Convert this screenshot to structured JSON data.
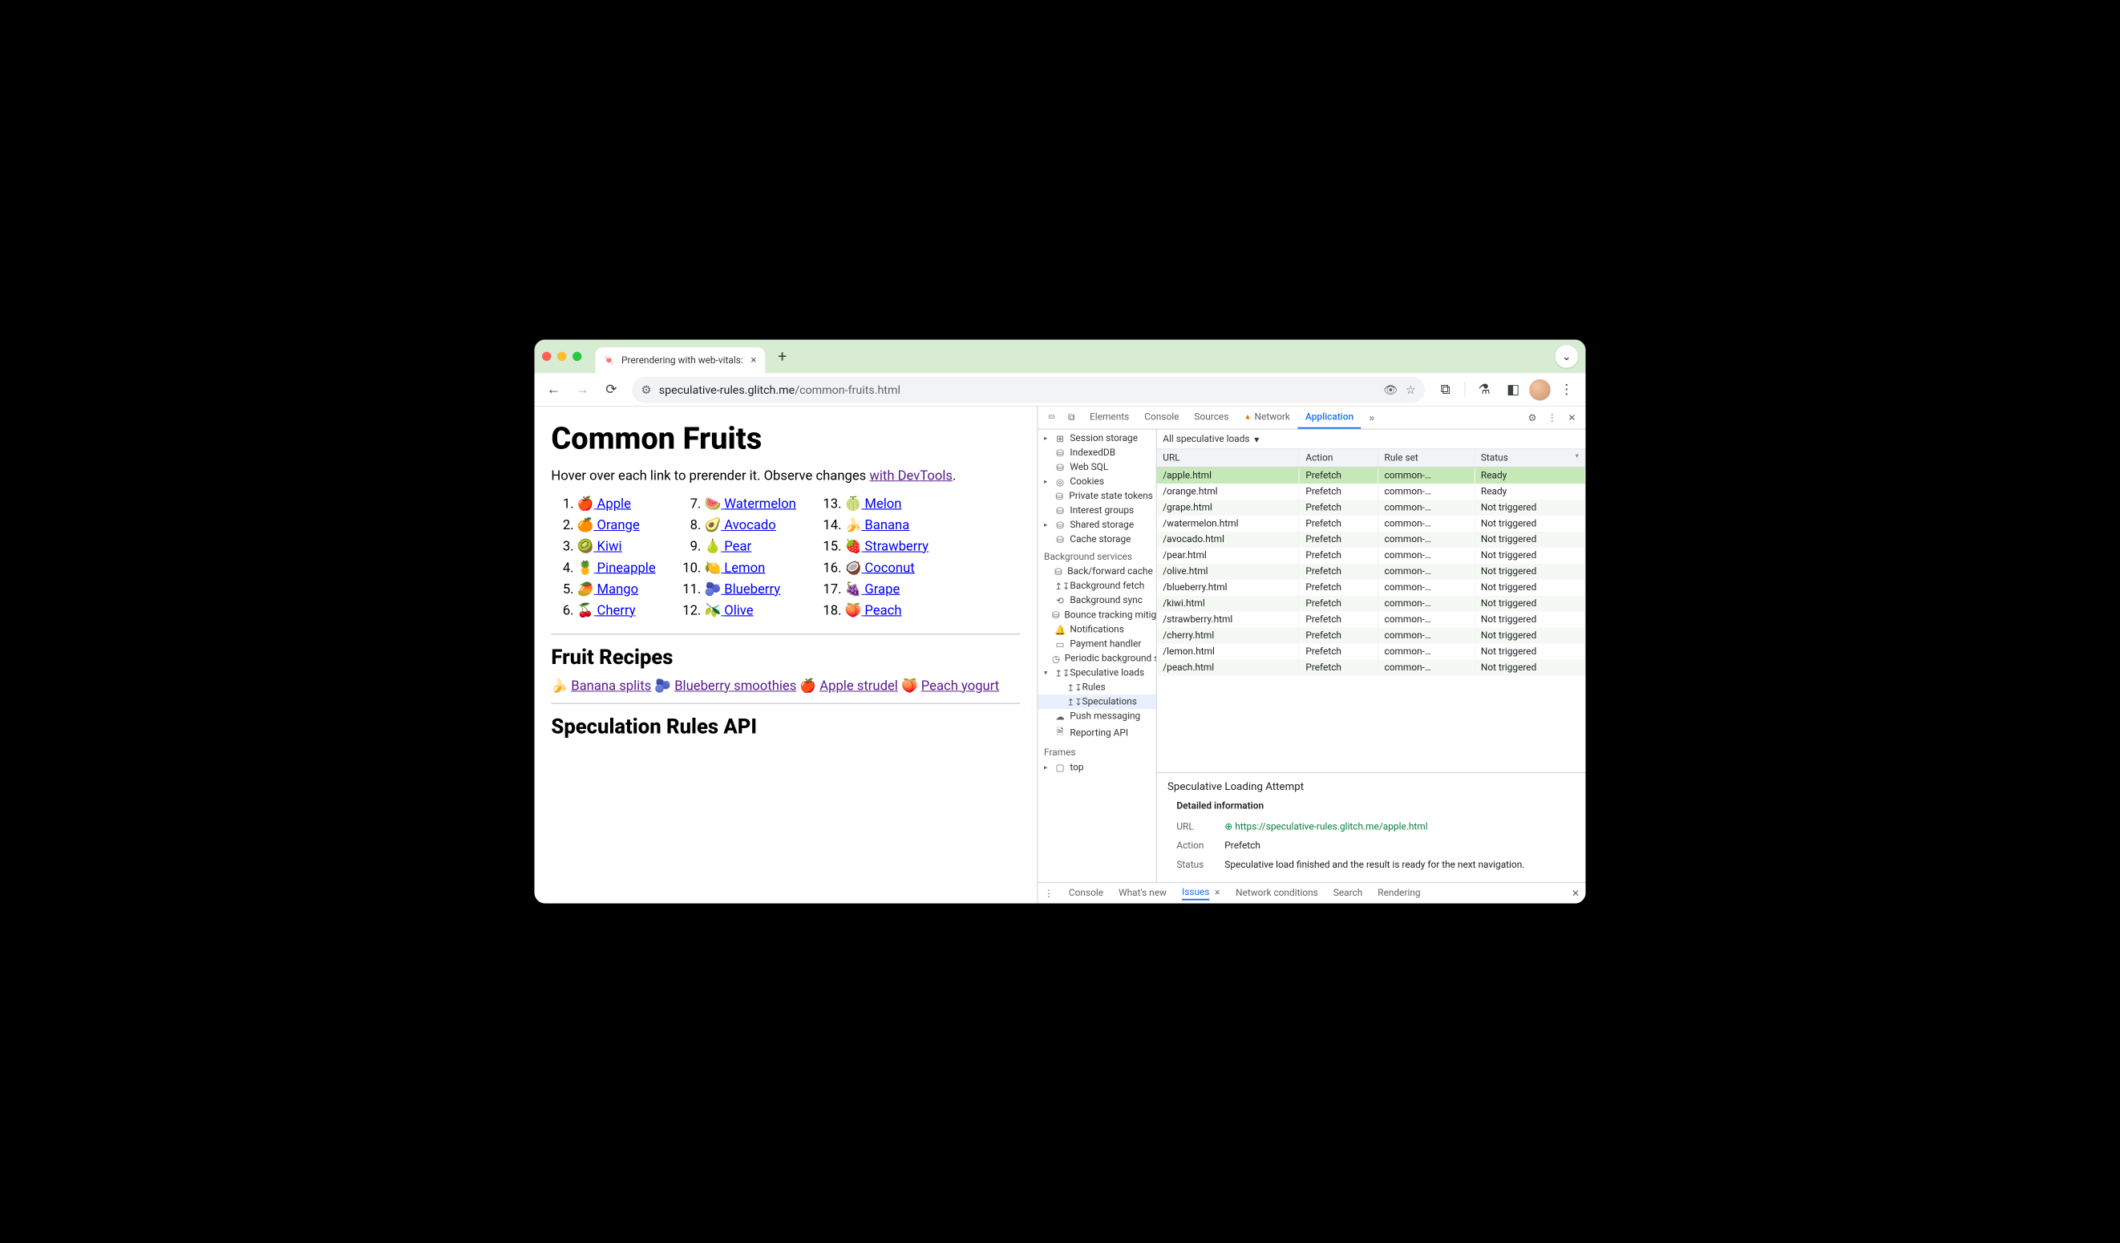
{
  "tab": {
    "title": "Prerendering with web-vitals:"
  },
  "url": {
    "host": "speculative-rules.glitch.me",
    "path": "/common-fruits.html"
  },
  "page": {
    "h1": "Common Fruits",
    "intro_a": "Hover over each link to prerender it. Observe changes ",
    "intro_link": "with DevTools",
    "intro_b": ".",
    "fruits": [
      {
        "n": "1.",
        "icon": "🍎",
        "label": "Apple"
      },
      {
        "n": "2.",
        "icon": "🍊",
        "label": "Orange"
      },
      {
        "n": "3.",
        "icon": "🥝",
        "label": "Kiwi"
      },
      {
        "n": "4.",
        "icon": "🍍",
        "label": "Pineapple"
      },
      {
        "n": "5.",
        "icon": "🥭",
        "label": "Mango"
      },
      {
        "n": "6.",
        "icon": "🍒",
        "label": "Cherry"
      },
      {
        "n": "7.",
        "icon": "🍉",
        "label": "Watermelon"
      },
      {
        "n": "8.",
        "icon": "🥑",
        "label": "Avocado"
      },
      {
        "n": "9.",
        "icon": "🍐",
        "label": "Pear"
      },
      {
        "n": "10.",
        "icon": "🍋",
        "label": "Lemon"
      },
      {
        "n": "11.",
        "icon": "🫐",
        "label": "Blueberry"
      },
      {
        "n": "12.",
        "icon": "🫒",
        "label": "Olive"
      },
      {
        "n": "13.",
        "icon": "🍈",
        "label": "Melon"
      },
      {
        "n": "14.",
        "icon": "🍌",
        "label": "Banana"
      },
      {
        "n": "15.",
        "icon": "🍓",
        "label": "Strawberry"
      },
      {
        "n": "16.",
        "icon": "🥥",
        "label": "Coconut"
      },
      {
        "n": "17.",
        "icon": "🍇",
        "label": "Grape"
      },
      {
        "n": "18.",
        "icon": "🍑",
        "label": "Peach"
      }
    ],
    "h2_recipes": "Fruit Recipes",
    "recipes": [
      {
        "icon": "🍌",
        "label": "Banana splits"
      },
      {
        "icon": "🫐",
        "label": "Blueberry smoothies"
      },
      {
        "icon": "🍎",
        "label": "Apple strudel"
      },
      {
        "icon": "🍑",
        "label": "Peach yogurt"
      }
    ],
    "h2_api": "Speculation Rules API"
  },
  "devtools": {
    "tabs": [
      "Elements",
      "Console",
      "Sources",
      "Network",
      "Application"
    ],
    "activeTab": "Application",
    "sidebar": {
      "storage": [
        {
          "label": "Session storage",
          "icon": "⊞",
          "caret": true
        },
        {
          "label": "IndexedDB",
          "icon": "⛁"
        },
        {
          "label": "Web SQL",
          "icon": "⛁"
        },
        {
          "label": "Cookies",
          "icon": "◎",
          "caret": true
        },
        {
          "label": "Private state tokens",
          "icon": "⛁"
        },
        {
          "label": "Interest groups",
          "icon": "⛁"
        },
        {
          "label": "Shared storage",
          "icon": "⛁",
          "caret": true
        },
        {
          "label": "Cache storage",
          "icon": "⛁"
        }
      ],
      "bg_label": "Background services",
      "bg": [
        {
          "label": "Back/forward cache",
          "icon": "⛁"
        },
        {
          "label": "Background fetch",
          "icon": "↥↧"
        },
        {
          "label": "Background sync",
          "icon": "⟲"
        },
        {
          "label": "Bounce tracking mitigations",
          "icon": "⛁"
        },
        {
          "label": "Notifications",
          "icon": "🔔"
        },
        {
          "label": "Payment handler",
          "icon": "▭"
        },
        {
          "label": "Periodic background sync",
          "icon": "◷"
        },
        {
          "label": "Speculative loads",
          "icon": "↥↧",
          "caret": true,
          "open": true
        },
        {
          "label": "Rules",
          "icon": "↥↧",
          "indent": true
        },
        {
          "label": "Speculations",
          "icon": "↥↧",
          "indent": true,
          "selected": true
        },
        {
          "label": "Push messaging",
          "icon": "☁"
        },
        {
          "label": "Reporting API",
          "icon": "🗎"
        }
      ],
      "frames_label": "Frames",
      "frames": [
        {
          "label": "top",
          "icon": "▢",
          "caret": true
        }
      ]
    },
    "filter_label": "All speculative loads",
    "columns": [
      "URL",
      "Action",
      "Rule set",
      "Status"
    ],
    "rows": [
      {
        "url": "/apple.html",
        "action": "Prefetch",
        "ruleset": "common-…",
        "status": "Ready",
        "selected": true
      },
      {
        "url": "/orange.html",
        "action": "Prefetch",
        "ruleset": "common-…",
        "status": "Ready"
      },
      {
        "url": "/grape.html",
        "action": "Prefetch",
        "ruleset": "common-…",
        "status": "Not triggered"
      },
      {
        "url": "/watermelon.html",
        "action": "Prefetch",
        "ruleset": "common-…",
        "status": "Not triggered"
      },
      {
        "url": "/avocado.html",
        "action": "Prefetch",
        "ruleset": "common-…",
        "status": "Not triggered"
      },
      {
        "url": "/pear.html",
        "action": "Prefetch",
        "ruleset": "common-…",
        "status": "Not triggered"
      },
      {
        "url": "/olive.html",
        "action": "Prefetch",
        "ruleset": "common-…",
        "status": "Not triggered"
      },
      {
        "url": "/blueberry.html",
        "action": "Prefetch",
        "ruleset": "common-…",
        "status": "Not triggered"
      },
      {
        "url": "/kiwi.html",
        "action": "Prefetch",
        "ruleset": "common-…",
        "status": "Not triggered"
      },
      {
        "url": "/strawberry.html",
        "action": "Prefetch",
        "ruleset": "common-…",
        "status": "Not triggered"
      },
      {
        "url": "/cherry.html",
        "action": "Prefetch",
        "ruleset": "common-…",
        "status": "Not triggered"
      },
      {
        "url": "/lemon.html",
        "action": "Prefetch",
        "ruleset": "common-…",
        "status": "Not triggered"
      },
      {
        "url": "/peach.html",
        "action": "Prefetch",
        "ruleset": "common-…",
        "status": "Not triggered"
      }
    ],
    "detail": {
      "title": "Speculative Loading Attempt",
      "section": "Detailed information",
      "url_label": "URL",
      "url": "https://speculative-rules.glitch.me/apple.html",
      "action_label": "Action",
      "action": "Prefetch",
      "status_label": "Status",
      "status": "Speculative load finished and the result is ready for the next navigation."
    },
    "drawer": [
      "Console",
      "What's new",
      "Issues",
      "Network conditions",
      "Search",
      "Rendering"
    ],
    "drawer_active": "Issues"
  }
}
